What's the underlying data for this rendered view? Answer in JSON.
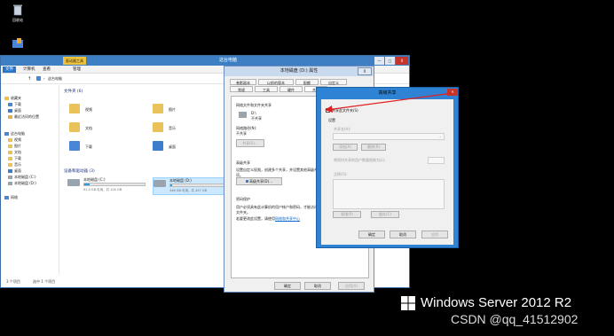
{
  "desktop": {
    "recycle_bin_label": "回收站"
  },
  "explorer": {
    "title": "这台电脑",
    "ribbon_context_tab": "驱动器工具",
    "tabs": [
      "文件",
      "计算机",
      "查看",
      "管理"
    ],
    "address": "这台电脑",
    "nav": {
      "favorites": "收藏夹",
      "fav_items": [
        "下载",
        "桌面",
        "最近访问的位置"
      ],
      "this_pc": "这台电脑",
      "pc_items": [
        "视频",
        "图片",
        "文档",
        "下载",
        "音乐",
        "桌面",
        "本地磁盘 (C:)",
        "本地磁盘 (D:)"
      ],
      "network": "网络"
    },
    "folders_header": "文件夹 (6)",
    "folders": [
      "视频",
      "图片",
      "文档",
      "音乐",
      "下载",
      "桌面"
    ],
    "devices_header": "设备和驱动器 (3)",
    "drives": [
      {
        "name": "本地磁盘 (C:)",
        "info": "91.4 GB 可用，共 100 GB",
        "used": 0.09
      },
      {
        "name": "本地磁盘 (D:)",
        "info": "446 GB 可用，共 457 GB",
        "used": 0.03
      }
    ],
    "status_left": "3 个项目",
    "status_selected": "选中 1 个项目",
    "window_buttons": [
      "—",
      "□",
      "X"
    ]
  },
  "props": {
    "title": "本地磁盘 (D:) 属性",
    "tabs_row1": [
      "卷影副本",
      "以前的版本",
      "配额",
      "自定义"
    ],
    "tabs_row2": [
      "常规",
      "工具",
      "硬件",
      "共享"
    ],
    "net_section": "网络文件和文件夹共享",
    "drive_label": "D:\\",
    "share_state": "不共享",
    "net_path_label": "网络路径(N):",
    "net_path_value": "不共享",
    "share_btn": "共享(S)...",
    "adv_section": "高级共享",
    "adv_desc": "设置自定义权限，创建多个共享，并设置其他高级共享选项。",
    "adv_btn": "高级共享(D)...",
    "pwd_section": "密码保护",
    "pwd_desc": "用户必须具有此计算机的用户帐户和密码，才能访问共享文件夹。",
    "pwd_desc2": "若要更改此设置，请使用",
    "pwd_link": "网络和共享中心",
    "ok": "确定",
    "cancel": "取消",
    "apply": "应用(A)"
  },
  "advanced": {
    "title": "高级共享",
    "share_checkbox": "共享此文件夹(S)",
    "settings": "设置",
    "share_name_label": "共享名(H):",
    "add_btn": "添加(A)",
    "remove_btn": "删除(R)",
    "limit_label": "将同时共享的用户数量限制为(L):",
    "comment_label": "注释(O):",
    "perm_btn": "权限(P)",
    "cache_btn": "缓存(C)",
    "ok": "确定",
    "cancel": "取消",
    "apply": "应用"
  },
  "watermark": {
    "windows": "Windows Server 2012 R2",
    "csdn": "CSDN @qq_41512902"
  },
  "colors": {
    "title_blue": "#3e7fc4",
    "adv_blue": "#2e83d4",
    "close_red": "#c7342c",
    "arrow_red": "#e02020"
  }
}
